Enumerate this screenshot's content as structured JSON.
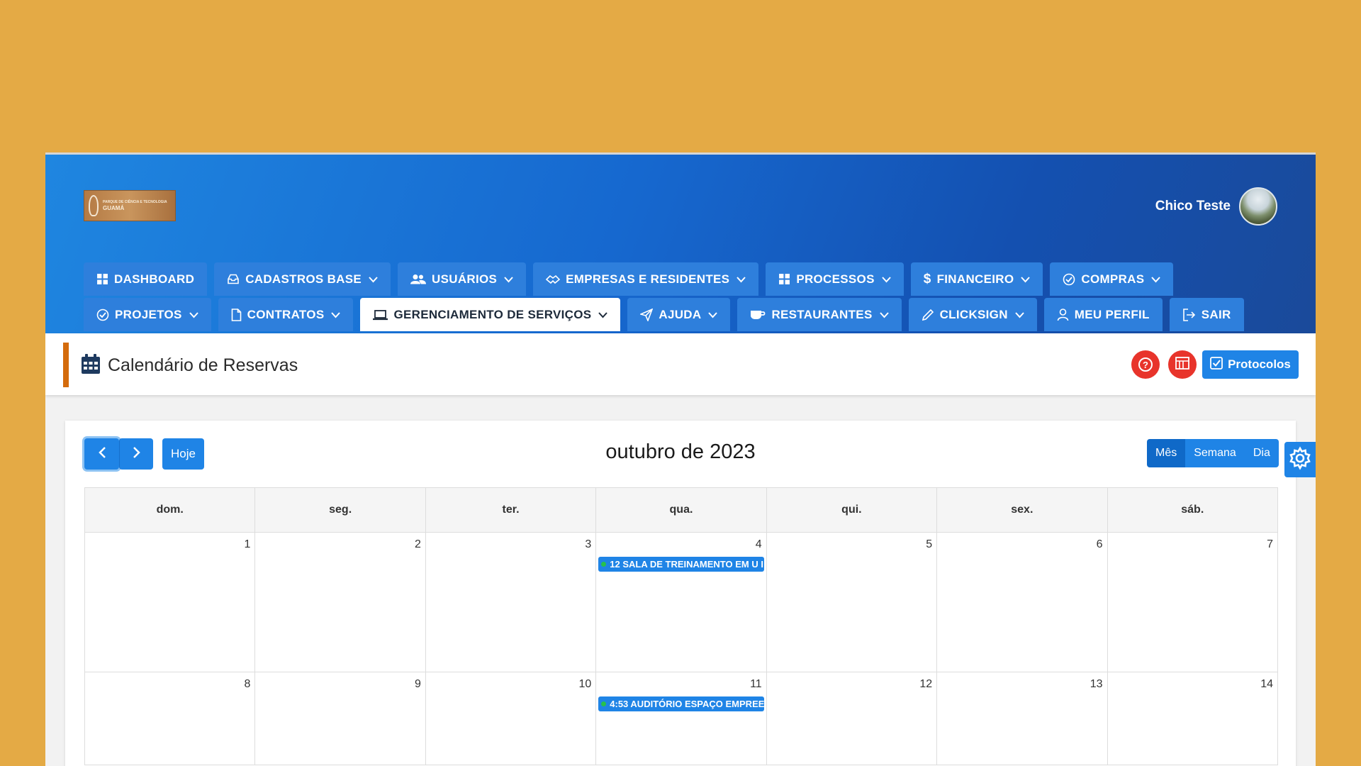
{
  "header": {
    "logo_text_1": "PARQUE DE CIÊNCIA E TECNOLOGIA",
    "logo_text_2": "GUAMÁ",
    "user_name": "Chico Teste"
  },
  "nav": {
    "row1": [
      {
        "label": "DASHBOARD",
        "icon": "grid-icon"
      },
      {
        "label": "CADASTROS BASE",
        "icon": "inbox-icon"
      },
      {
        "label": "USUÁRIOS",
        "icon": "users-icon"
      },
      {
        "label": "EMPRESAS E RESIDENTES",
        "icon": "handshake-icon"
      },
      {
        "label": "PROCESSOS",
        "icon": "grid-icon"
      },
      {
        "label": "FINANCEIRO",
        "icon": "dollar-icon"
      },
      {
        "label": "COMPRAS",
        "icon": "check-circle-icon"
      }
    ],
    "row2": [
      {
        "label": "PROJETOS",
        "icon": "check-circle-icon"
      },
      {
        "label": "CONTRATOS",
        "icon": "file-icon"
      },
      {
        "label": "GERENCIAMENTO DE SERVIÇOS",
        "icon": "laptop-icon"
      },
      {
        "label": "AJUDA",
        "icon": "paper-plane-icon"
      },
      {
        "label": "RESTAURANTES",
        "icon": "coffee-icon"
      },
      {
        "label": "CLICKSIGN",
        "icon": "pencil-icon"
      },
      {
        "label": "MEU PERFIL",
        "icon": "user-icon"
      },
      {
        "label": "SAIR",
        "icon": "logout-icon"
      }
    ]
  },
  "page": {
    "title": "Calendário de Reservas",
    "help_symbol": "?",
    "protocol_label": "Protocolos"
  },
  "calendar": {
    "prev_symbol": "‹",
    "next_symbol": "›",
    "today_label": "Hoje",
    "title": "outubro de 2023",
    "views": [
      "Mês",
      "Semana",
      "Dia"
    ],
    "weekdays": [
      "dom.",
      "seg.",
      "ter.",
      "qua.",
      "qui.",
      "sex.",
      "sáb."
    ],
    "week1": [
      "1",
      "2",
      "3",
      "4",
      "5",
      "6",
      "7"
    ],
    "week2": [
      "8",
      "9",
      "10",
      "11",
      "12",
      "13",
      "14"
    ],
    "events": {
      "oct4": "12 SALA DE TREINAMENTO EM U I",
      "oct11": "4:53 AUDITÓRIO ESPAÇO EMPREE"
    }
  },
  "colors": {
    "background": "#e4aa45",
    "primary": "#1f84e6",
    "danger": "#e8342b",
    "accent": "#d46b0c"
  }
}
